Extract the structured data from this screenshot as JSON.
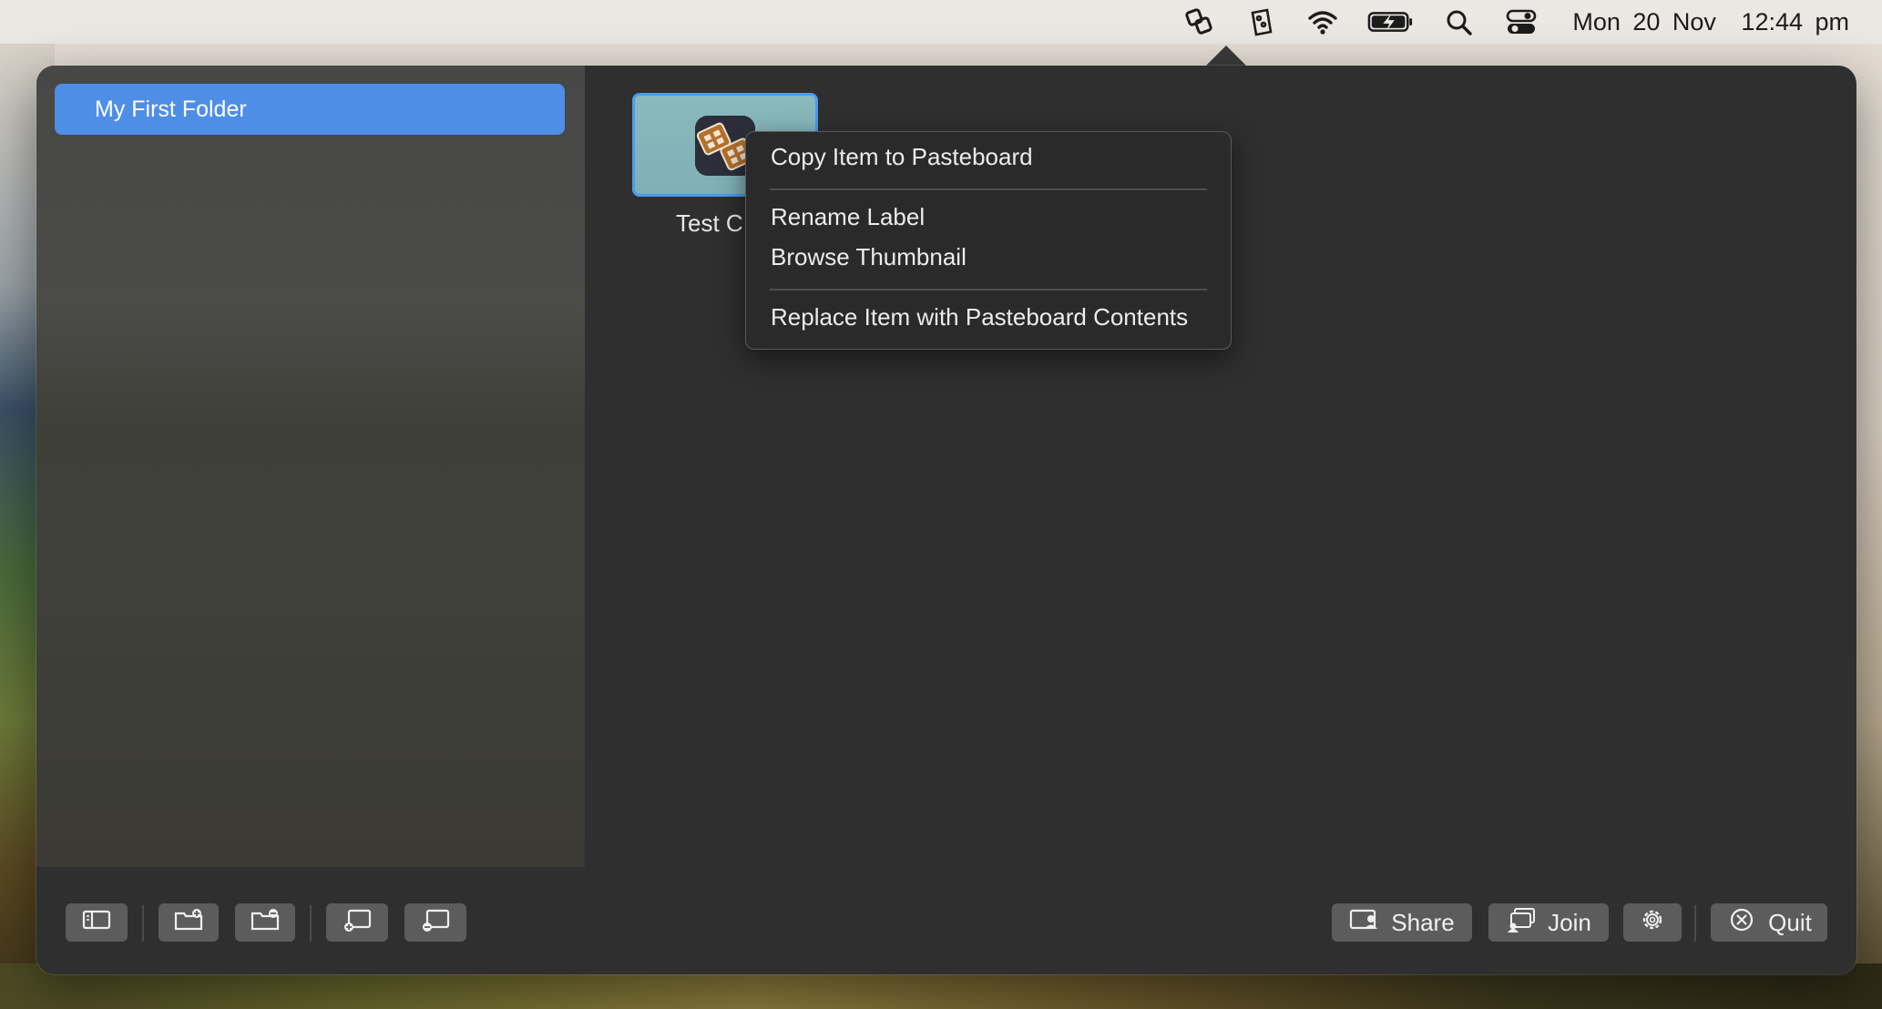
{
  "menubar": {
    "icons": [
      "app-status-icon",
      "clipboard-tool-icon",
      "wifi-icon",
      "battery-charging-icon",
      "spotlight-search-icon",
      "control-center-icon"
    ],
    "date": "Mon 20 Nov",
    "time": "12:44 pm"
  },
  "sidebar": {
    "folders": [
      {
        "label": "My First Folder",
        "selected": true
      }
    ]
  },
  "content": {
    "item": {
      "label_visible": "Test C",
      "icon": "film-reel-app-icon"
    }
  },
  "context_menu": {
    "copy": "Copy Item to Pasteboard",
    "rename": "Rename Label",
    "browse": "Browse Thumbnail",
    "replace": "Replace Item with Pasteboard Contents"
  },
  "toolbar": {
    "left_icons": [
      "sidebar-toggle-icon",
      "add-folder-icon",
      "remove-folder-icon",
      "add-item-icon",
      "remove-item-icon"
    ],
    "share_label": "Share",
    "join_label": "Join",
    "quit_label": "Quit"
  },
  "colors": {
    "accent": "#4f8ee6",
    "popover_bg": "#2f2f2f",
    "menubar_bg": "#ebe7e2"
  }
}
